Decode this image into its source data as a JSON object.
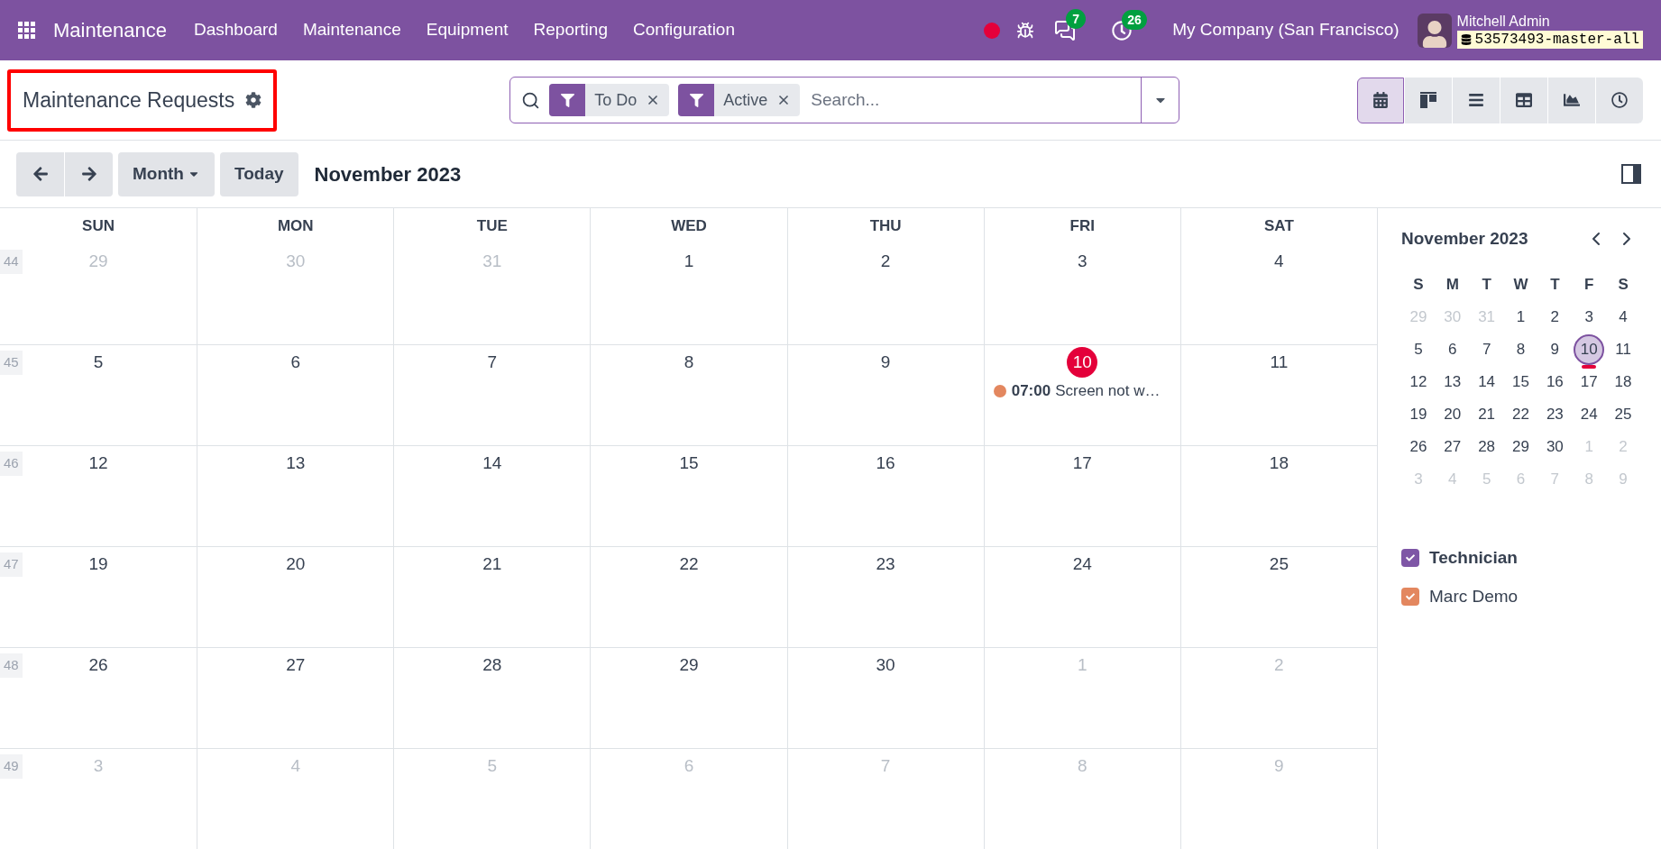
{
  "navbar": {
    "app_name": "Maintenance",
    "menu": [
      {
        "label": "Dashboard"
      },
      {
        "label": "Maintenance"
      },
      {
        "label": "Equipment"
      },
      {
        "label": "Reporting"
      },
      {
        "label": "Configuration"
      }
    ],
    "messages_count": "7",
    "activities_count": "26",
    "company": "My Company (San Francisco)",
    "user_name": "Mitchell Admin",
    "database": "53573493-master-all"
  },
  "control_panel": {
    "title": "Maintenance Requests",
    "highlighted": true,
    "facets": [
      {
        "label": "To Do"
      },
      {
        "label": "Active"
      }
    ],
    "search_placeholder": "Search...",
    "views": [
      {
        "kind": "calendar",
        "selected": true
      },
      {
        "kind": "kanban",
        "selected": false
      },
      {
        "kind": "list",
        "selected": false
      },
      {
        "kind": "pivot",
        "selected": false
      },
      {
        "kind": "graph",
        "selected": false
      },
      {
        "kind": "activity",
        "selected": false
      }
    ]
  },
  "toolbar": {
    "scale": "Month",
    "today": "Today",
    "period": "November 2023"
  },
  "calendar": {
    "weekdays": [
      "SUN",
      "MON",
      "TUE",
      "WED",
      "THU",
      "FRI",
      "SAT"
    ],
    "weeks": [
      {
        "number": "44",
        "days": [
          {
            "label": "29",
            "muted": true,
            "today": false
          },
          {
            "label": "30",
            "muted": true,
            "today": false
          },
          {
            "label": "31",
            "muted": true,
            "today": false
          },
          {
            "label": "1",
            "muted": false,
            "today": false
          },
          {
            "label": "2",
            "muted": false,
            "today": false
          },
          {
            "label": "3",
            "muted": false,
            "today": false
          },
          {
            "label": "4",
            "muted": false,
            "today": false
          }
        ]
      },
      {
        "number": "45",
        "days": [
          {
            "label": "5",
            "muted": false,
            "today": false
          },
          {
            "label": "6",
            "muted": false,
            "today": false
          },
          {
            "label": "7",
            "muted": false,
            "today": false
          },
          {
            "label": "8",
            "muted": false,
            "today": false
          },
          {
            "label": "9",
            "muted": false,
            "today": false
          },
          {
            "label": "10",
            "muted": false,
            "today": true,
            "events": [
              {
                "time": "07:00",
                "title": "Screen not w…",
                "color": "#e3875f"
              }
            ]
          },
          {
            "label": "11",
            "muted": false,
            "today": false
          }
        ]
      },
      {
        "number": "46",
        "days": [
          {
            "label": "12",
            "muted": false,
            "today": false
          },
          {
            "label": "13",
            "muted": false,
            "today": false
          },
          {
            "label": "14",
            "muted": false,
            "today": false
          },
          {
            "label": "15",
            "muted": false,
            "today": false
          },
          {
            "label": "16",
            "muted": false,
            "today": false
          },
          {
            "label": "17",
            "muted": false,
            "today": false
          },
          {
            "label": "18",
            "muted": false,
            "today": false
          }
        ]
      },
      {
        "number": "47",
        "days": [
          {
            "label": "19",
            "muted": false,
            "today": false
          },
          {
            "label": "20",
            "muted": false,
            "today": false
          },
          {
            "label": "21",
            "muted": false,
            "today": false
          },
          {
            "label": "22",
            "muted": false,
            "today": false
          },
          {
            "label": "23",
            "muted": false,
            "today": false
          },
          {
            "label": "24",
            "muted": false,
            "today": false
          },
          {
            "label": "25",
            "muted": false,
            "today": false
          }
        ]
      },
      {
        "number": "48",
        "days": [
          {
            "label": "26",
            "muted": false,
            "today": false
          },
          {
            "label": "27",
            "muted": false,
            "today": false
          },
          {
            "label": "28",
            "muted": false,
            "today": false
          },
          {
            "label": "29",
            "muted": false,
            "today": false
          },
          {
            "label": "30",
            "muted": false,
            "today": false
          },
          {
            "label": "1",
            "muted": true,
            "today": false
          },
          {
            "label": "2",
            "muted": true,
            "today": false
          }
        ]
      },
      {
        "number": "49",
        "days": [
          {
            "label": "3",
            "muted": true,
            "today": false
          },
          {
            "label": "4",
            "muted": true,
            "today": false
          },
          {
            "label": "5",
            "muted": true,
            "today": false
          },
          {
            "label": "6",
            "muted": true,
            "today": false
          },
          {
            "label": "7",
            "muted": true,
            "today": false
          },
          {
            "label": "8",
            "muted": true,
            "today": false
          },
          {
            "label": "9",
            "muted": true,
            "today": false
          }
        ]
      }
    ]
  },
  "sidebar": {
    "mini_calendar": {
      "title": "November 2023",
      "weekdays": [
        "S",
        "M",
        "T",
        "W",
        "T",
        "F",
        "S"
      ],
      "weeks": [
        [
          {
            "label": "29",
            "muted": true,
            "selected": false,
            "today": false
          },
          {
            "label": "30",
            "muted": true,
            "selected": false,
            "today": false
          },
          {
            "label": "31",
            "muted": true,
            "selected": false,
            "today": false
          },
          {
            "label": "1",
            "muted": false,
            "selected": false,
            "today": false
          },
          {
            "label": "2",
            "muted": false,
            "selected": false,
            "today": false
          },
          {
            "label": "3",
            "muted": false,
            "selected": false,
            "today": false
          },
          {
            "label": "4",
            "muted": false,
            "selected": false,
            "today": false
          }
        ],
        [
          {
            "label": "5",
            "muted": false,
            "selected": false,
            "today": false
          },
          {
            "label": "6",
            "muted": false,
            "selected": false,
            "today": false
          },
          {
            "label": "7",
            "muted": false,
            "selected": false,
            "today": false
          },
          {
            "label": "8",
            "muted": false,
            "selected": false,
            "today": false
          },
          {
            "label": "9",
            "muted": false,
            "selected": false,
            "today": false
          },
          {
            "label": "10",
            "muted": false,
            "selected": true,
            "today": true
          },
          {
            "label": "11",
            "muted": false,
            "selected": false,
            "today": false
          }
        ],
        [
          {
            "label": "12",
            "muted": false,
            "selected": false,
            "today": false
          },
          {
            "label": "13",
            "muted": false,
            "selected": false,
            "today": false
          },
          {
            "label": "14",
            "muted": false,
            "selected": false,
            "today": false
          },
          {
            "label": "15",
            "muted": false,
            "selected": false,
            "today": false
          },
          {
            "label": "16",
            "muted": false,
            "selected": false,
            "today": false
          },
          {
            "label": "17",
            "muted": false,
            "selected": false,
            "today": false
          },
          {
            "label": "18",
            "muted": false,
            "selected": false,
            "today": false
          }
        ],
        [
          {
            "label": "19",
            "muted": false,
            "selected": false,
            "today": false
          },
          {
            "label": "20",
            "muted": false,
            "selected": false,
            "today": false
          },
          {
            "label": "21",
            "muted": false,
            "selected": false,
            "today": false
          },
          {
            "label": "22",
            "muted": false,
            "selected": false,
            "today": false
          },
          {
            "label": "23",
            "muted": false,
            "selected": false,
            "today": false
          },
          {
            "label": "24",
            "muted": false,
            "selected": false,
            "today": false
          },
          {
            "label": "25",
            "muted": false,
            "selected": false,
            "today": false
          }
        ],
        [
          {
            "label": "26",
            "muted": false,
            "selected": false,
            "today": false
          },
          {
            "label": "27",
            "muted": false,
            "selected": false,
            "today": false
          },
          {
            "label": "28",
            "muted": false,
            "selected": false,
            "today": false
          },
          {
            "label": "29",
            "muted": false,
            "selected": false,
            "today": false
          },
          {
            "label": "30",
            "muted": false,
            "selected": false,
            "today": false
          },
          {
            "label": "1",
            "muted": true,
            "selected": false,
            "today": false
          },
          {
            "label": "2",
            "muted": true,
            "selected": false,
            "today": false
          }
        ],
        [
          {
            "label": "3",
            "muted": true,
            "selected": false,
            "today": false
          },
          {
            "label": "4",
            "muted": true,
            "selected": false,
            "today": false
          },
          {
            "label": "5",
            "muted": true,
            "selected": false,
            "today": false
          },
          {
            "label": "6",
            "muted": true,
            "selected": false,
            "today": false
          },
          {
            "label": "7",
            "muted": true,
            "selected": false,
            "today": false
          },
          {
            "label": "8",
            "muted": true,
            "selected": false,
            "today": false
          },
          {
            "label": "9",
            "muted": true,
            "selected": false,
            "today": false
          }
        ]
      ]
    },
    "filters": [
      {
        "kind": "header",
        "label": "Technician",
        "checked": true,
        "color": "#7e56a6"
      },
      {
        "kind": "item",
        "label": "Marc Demo",
        "checked": true,
        "color": "#e3875f"
      }
    ]
  }
}
